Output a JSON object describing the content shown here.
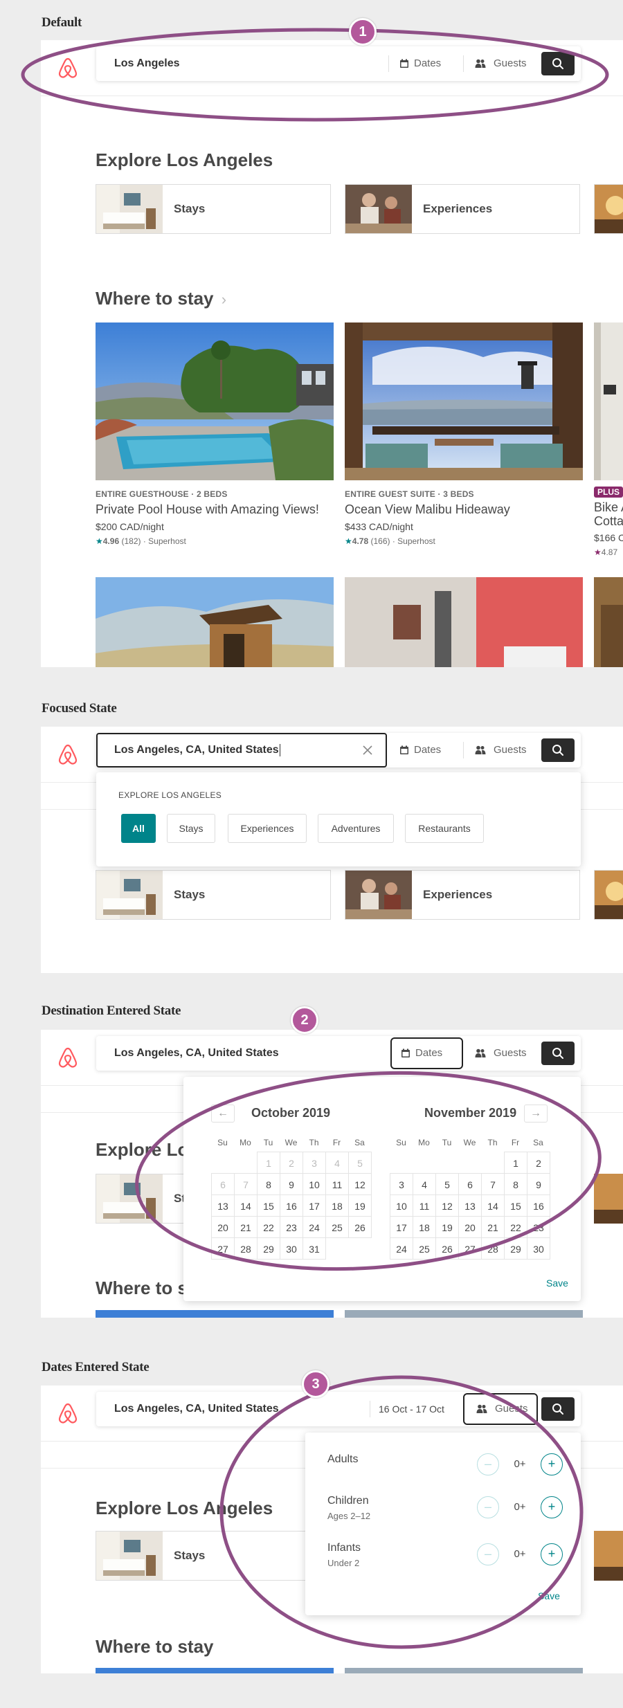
{
  "states": {
    "default": "Default",
    "focused": "Focused State",
    "destination": "Destination Entered State",
    "dates": "Dates Entered State"
  },
  "search": {
    "location_short": "Los Angeles",
    "location_full": "Los Angeles, CA, United States",
    "dates_label": "Dates",
    "dates_value": "16 Oct - 17 Oct",
    "guests_label": "Guests"
  },
  "explore": {
    "title": "Explore Los Angeles",
    "stays": "Stays",
    "experiences": "Experiences"
  },
  "where": {
    "title": "Where to stay",
    "chevron": "›"
  },
  "listings": [
    {
      "type": "ENTIRE GUESTHOUSE · 2 BEDS",
      "title": "Private Pool House with Amazing Views!",
      "price": "$200 CAD/night",
      "rating": "4.96",
      "reviews": "(182)",
      "host": "· Superhost"
    },
    {
      "type": "ENTIRE GUEST SUITE · 3 BEDS",
      "title": "Ocean View Malibu Hideaway",
      "price": "$433 CAD/night",
      "rating": "4.78",
      "reviews": "(166)",
      "host": "· Superhost"
    },
    {
      "badge": "PLUS",
      "title": "Bike A Cotta",
      "price": "$166 C",
      "rating": "4.87"
    }
  ],
  "dropdown": {
    "heading": "EXPLORE LOS ANGELES",
    "chips": [
      "All",
      "Stays",
      "Experiences",
      "Adventures",
      "Restaurants"
    ]
  },
  "calendar": {
    "prev_arrow": "←",
    "next_arrow": "→",
    "weekdays": [
      "Su",
      "Mo",
      "Tu",
      "We",
      "Th",
      "Fr",
      "Sa"
    ],
    "months": [
      {
        "name": "October 2019",
        "offset": 2,
        "days": 31,
        "past_until": 8
      },
      {
        "name": "November 2019",
        "offset": 5,
        "days": 30,
        "past_until": 0
      }
    ],
    "save": "Save"
  },
  "guests": {
    "rows": [
      {
        "name": "Adults",
        "sub": "",
        "value": "0+"
      },
      {
        "name": "Children",
        "sub": "Ages 2–12",
        "value": "0+"
      },
      {
        "name": "Infants",
        "sub": "Under 2",
        "value": "0+"
      }
    ],
    "minus": "–",
    "plus": "+",
    "save": "Save"
  },
  "annotations": [
    "1",
    "2",
    "3"
  ],
  "colors": {
    "brand": "#ff5a5f",
    "teal": "#00848a",
    "annotation": "#8e4f86"
  }
}
